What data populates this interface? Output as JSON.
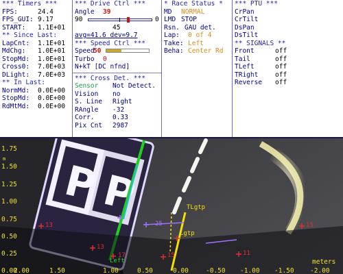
{
  "timers": {
    "header": "*** Timers ***",
    "rows": [
      {
        "label": "FPS:",
        "value": "24.4"
      },
      {
        "label": "FPS_GUI:",
        "value": "9.17"
      },
      {
        "label": "START:",
        "value": "1.1E+01"
      }
    ],
    "since_header": "** Since Last:",
    "since_rows": [
      {
        "label": "LapCnt:",
        "value": "1.1E+01"
      },
      {
        "label": "MdChg:",
        "value": "1.0E+01"
      },
      {
        "label": "StopMd:",
        "value": "1.0E+01"
      },
      {
        "label": "Cross0:",
        "value": "7.0E+03"
      },
      {
        "label": "DLight:",
        "value": "7.0E+03"
      }
    ],
    "in_header": "** In Last:",
    "in_rows": [
      {
        "label": "NormMd:",
        "value": "0.0E+00"
      },
      {
        "label": "StopMd:",
        "value": "0.0E+00"
      },
      {
        "label": "RdMtMd:",
        "value": "0.0E+00"
      }
    ]
  },
  "drive": {
    "header": "***  Drive Ctrl  ***",
    "angle_label": "Angle",
    "angle_value": "39",
    "slider_min": "90",
    "slider_max": "0",
    "slider_position": 0.62,
    "slider_mid": "45",
    "avg_dev": "avg=41.6  dev=9.7",
    "speed_header": "***  Speed Ctrl  ***",
    "speed_label": "Speed",
    "speed_value": "50",
    "speed_level": 0.35,
    "turbo_label": "Turbo",
    "turbo_value": "0",
    "nkt": "N+kT [DC nfnd]",
    "cross_header": "*** Cross Det. ***",
    "cross_rows": [
      {
        "label": "Sensor",
        "value": "Not Detect.",
        "color": "#1ea050"
      },
      {
        "label": "Vision",
        "value": "no",
        "color": "#000080"
      },
      {
        "label": "S. Line",
        "value": "Right",
        "color": "#000080"
      },
      {
        "label": "RAngle",
        "value": "-32",
        "color": "#000080"
      },
      {
        "label": "Corr.",
        "value": "0.33",
        "color": "#000080"
      },
      {
        "label": "Pix Cnt",
        "value": "2987",
        "color": "#000080"
      }
    ]
  },
  "race": {
    "header": "* Race Status *",
    "rows": [
      {
        "label": "MD",
        "value": "NORMAL",
        "color": "#d98c1a"
      },
      {
        "label": "LMD",
        "value": "STOP",
        "color": "#000080"
      },
      {
        "label": "Rsn.",
        "value": "GAU det.",
        "color": "#000080"
      },
      {
        "label": "Lap:",
        "value": "0 of 4",
        "color": "#d98c1a"
      },
      {
        "label": "Take:",
        "value": "Left",
        "color": "#d98c1a"
      },
      {
        "label": "Beha:",
        "value": "Center Rd",
        "color": "#d98c1a"
      }
    ]
  },
  "ptu": {
    "header": "*** PTU ***",
    "rows": [
      "CrPan",
      "CrTilt",
      "DsPan",
      "DsTilt"
    ],
    "signals_header": "** SIGNALS **",
    "signals": [
      {
        "label": "Front",
        "value": "off"
      },
      {
        "label": "Tail",
        "value": "off"
      },
      {
        "label": "TLeft",
        "value": "off"
      },
      {
        "label": "TRight",
        "value": "off"
      },
      {
        "label": "Reverse",
        "value": "off"
      }
    ]
  },
  "camera": {
    "y_ticks": [
      "1.75",
      "1.50",
      "1.25",
      "1.00",
      "0.75",
      "0.50",
      "0.25",
      "0.00"
    ],
    "x_ticks": [
      "2.00",
      "1.50",
      "1.00",
      "0.50",
      "0.00",
      "-0.50",
      "-1.00",
      "-1.50",
      "-2.00"
    ],
    "x_unit": "meters",
    "y_unit_small": "m",
    "labels": {
      "tlgtp": "TLgtp",
      "lgtp": "Lgtp",
      "left": "Left",
      "p1": "13",
      "p2": "15",
      "p3": "11",
      "p4": "17",
      "p5": "13",
      "p6": "15",
      "p7": "25"
    },
    "colors": {
      "axis": "#f0e030",
      "marker": "#e03030",
      "line": "#f5e000",
      "green": "#20d020",
      "purple": "#a070ff"
    }
  }
}
